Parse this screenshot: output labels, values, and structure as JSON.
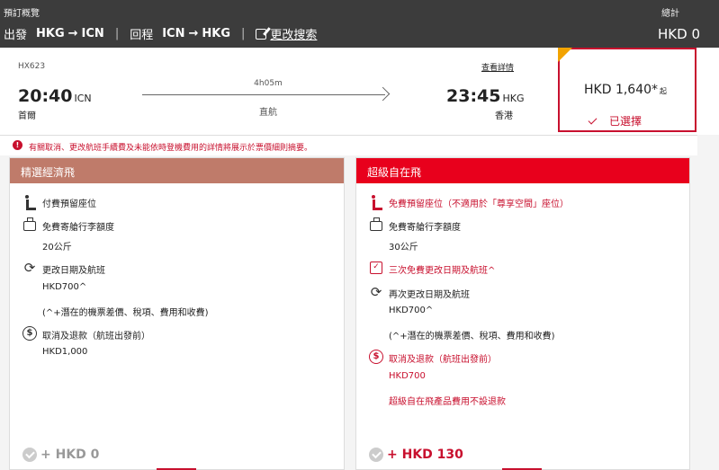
{
  "header": {
    "title": "預訂概覽",
    "total_label": "總計",
    "total_value": "HKD 0",
    "outbound_label": "出發",
    "outbound_from": "HKG",
    "outbound_to": "ICN",
    "return_label": "回程",
    "return_from": "ICN",
    "return_to": "HKG",
    "arrow": "→",
    "separator": "|",
    "edit_search": "更改搜索"
  },
  "flight": {
    "number": "HX623",
    "details_link": "查看詳情",
    "dep_time": "20:40",
    "dep_code": "ICN",
    "dep_city": "首爾",
    "duration": "4h05m",
    "stops": "直航",
    "arr_time": "23:45",
    "arr_code": "HKG",
    "arr_city": "香港"
  },
  "price": {
    "value": "HKD 1,640*",
    "suffix": "起",
    "selected_label": "已選擇"
  },
  "notice": {
    "icon": "!",
    "text": "有關取消、更改航班手續費及未能依時登機費用的詳情將展示於票價細則摘要。"
  },
  "fares": [
    {
      "name": "精選經濟飛",
      "seat": "付費預留座位",
      "baggage": "免費寄艙行李額度",
      "baggage_amount": "20公斤",
      "change": "更改日期及航班",
      "change_fee": "HKD700^",
      "change_note": "(^+潛在的機票差價、稅項、費用和收費)",
      "refund": "取消及退款（航班出發前）",
      "refund_fee": "HKD1,000",
      "price_delta": "+ HKD 0"
    },
    {
      "name": "超級自在飛",
      "seat": "免費預留座位（不適用於「尊享空間」座位）",
      "baggage": "免費寄艙行李額度",
      "baggage_amount": "30公斤",
      "free_changes": "三次免費更改日期及航班^",
      "change": "再次更改日期及航班",
      "change_fee": "HKD700^",
      "change_note": "(^+潛在的機票差價、稅項、費用和收費)",
      "refund": "取消及退款（航班出發前）",
      "refund_fee": "HKD700",
      "refund_note": "超級自在飛產品費用不設退款",
      "price_delta": "+ HKD 130"
    }
  ],
  "colors": {
    "header_bg": "#3c3c3c",
    "accent_red": "#c8102e",
    "fare1_header": "#bf7b6a",
    "fare2_header": "#e8001c",
    "selected_corner": "#f2a300"
  }
}
